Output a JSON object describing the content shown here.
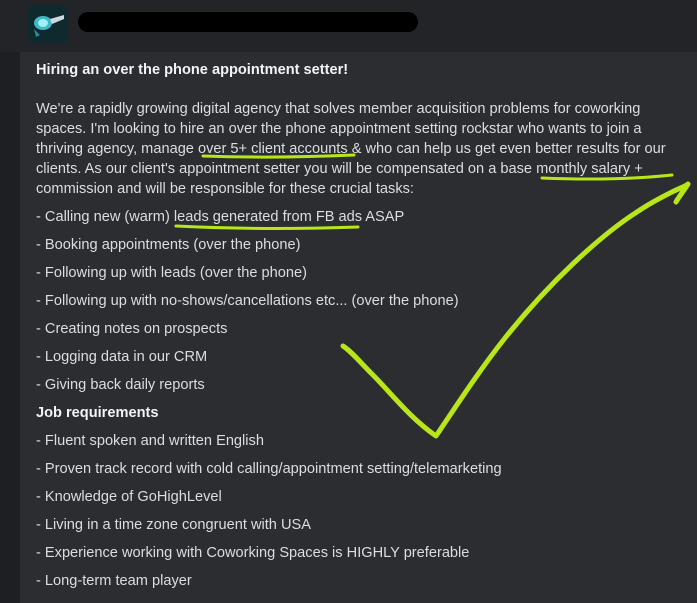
{
  "post": {
    "title": "Hiring an over the phone appointment setter!",
    "intro_parts": [
      "We're a rapidly growing digital agency that solves member acquisition problems for coworking spaces. I'm looking to hire an over the phone appointment setting rockstar who wants to join a thriving agency, manage ",
      "over 5+ client accounts",
      " & who can help us get even better results for our clients. As our client's appointment setter you will be compensated on a ",
      "base monthly salary",
      " + commission and will be responsible for these crucial tasks:"
    ],
    "task_first_parts": [
      "- Calling new (warm) ",
      "leads generated from FB ads",
      " ASAP"
    ],
    "tasks": [
      "- Booking appointments (over the phone)",
      "- Following up with leads (over the phone)",
      "- Following up with no-shows/cancellations etc... (over the phone)",
      "- Creating notes on prospects",
      "- Logging data in our CRM",
      "- Giving back daily reports"
    ],
    "requirements_heading": "Job requirements",
    "requirements": [
      "- Fluent spoken and written English",
      "- Proven track record with cold calling/appointment setting/telemarketing",
      "- Knowledge of GoHighLevel",
      "- Living in a time zone congruent with USA",
      "- Experience working with Coworking Spaces is HIGHLY preferable",
      "- Long-term team player"
    ]
  },
  "colors": {
    "annotation": "#b8e619",
    "background": "#2b2d31",
    "redaction": "#000000"
  },
  "icons": {
    "avatar": "avatar-image",
    "annotation": "checkmark-icon"
  }
}
